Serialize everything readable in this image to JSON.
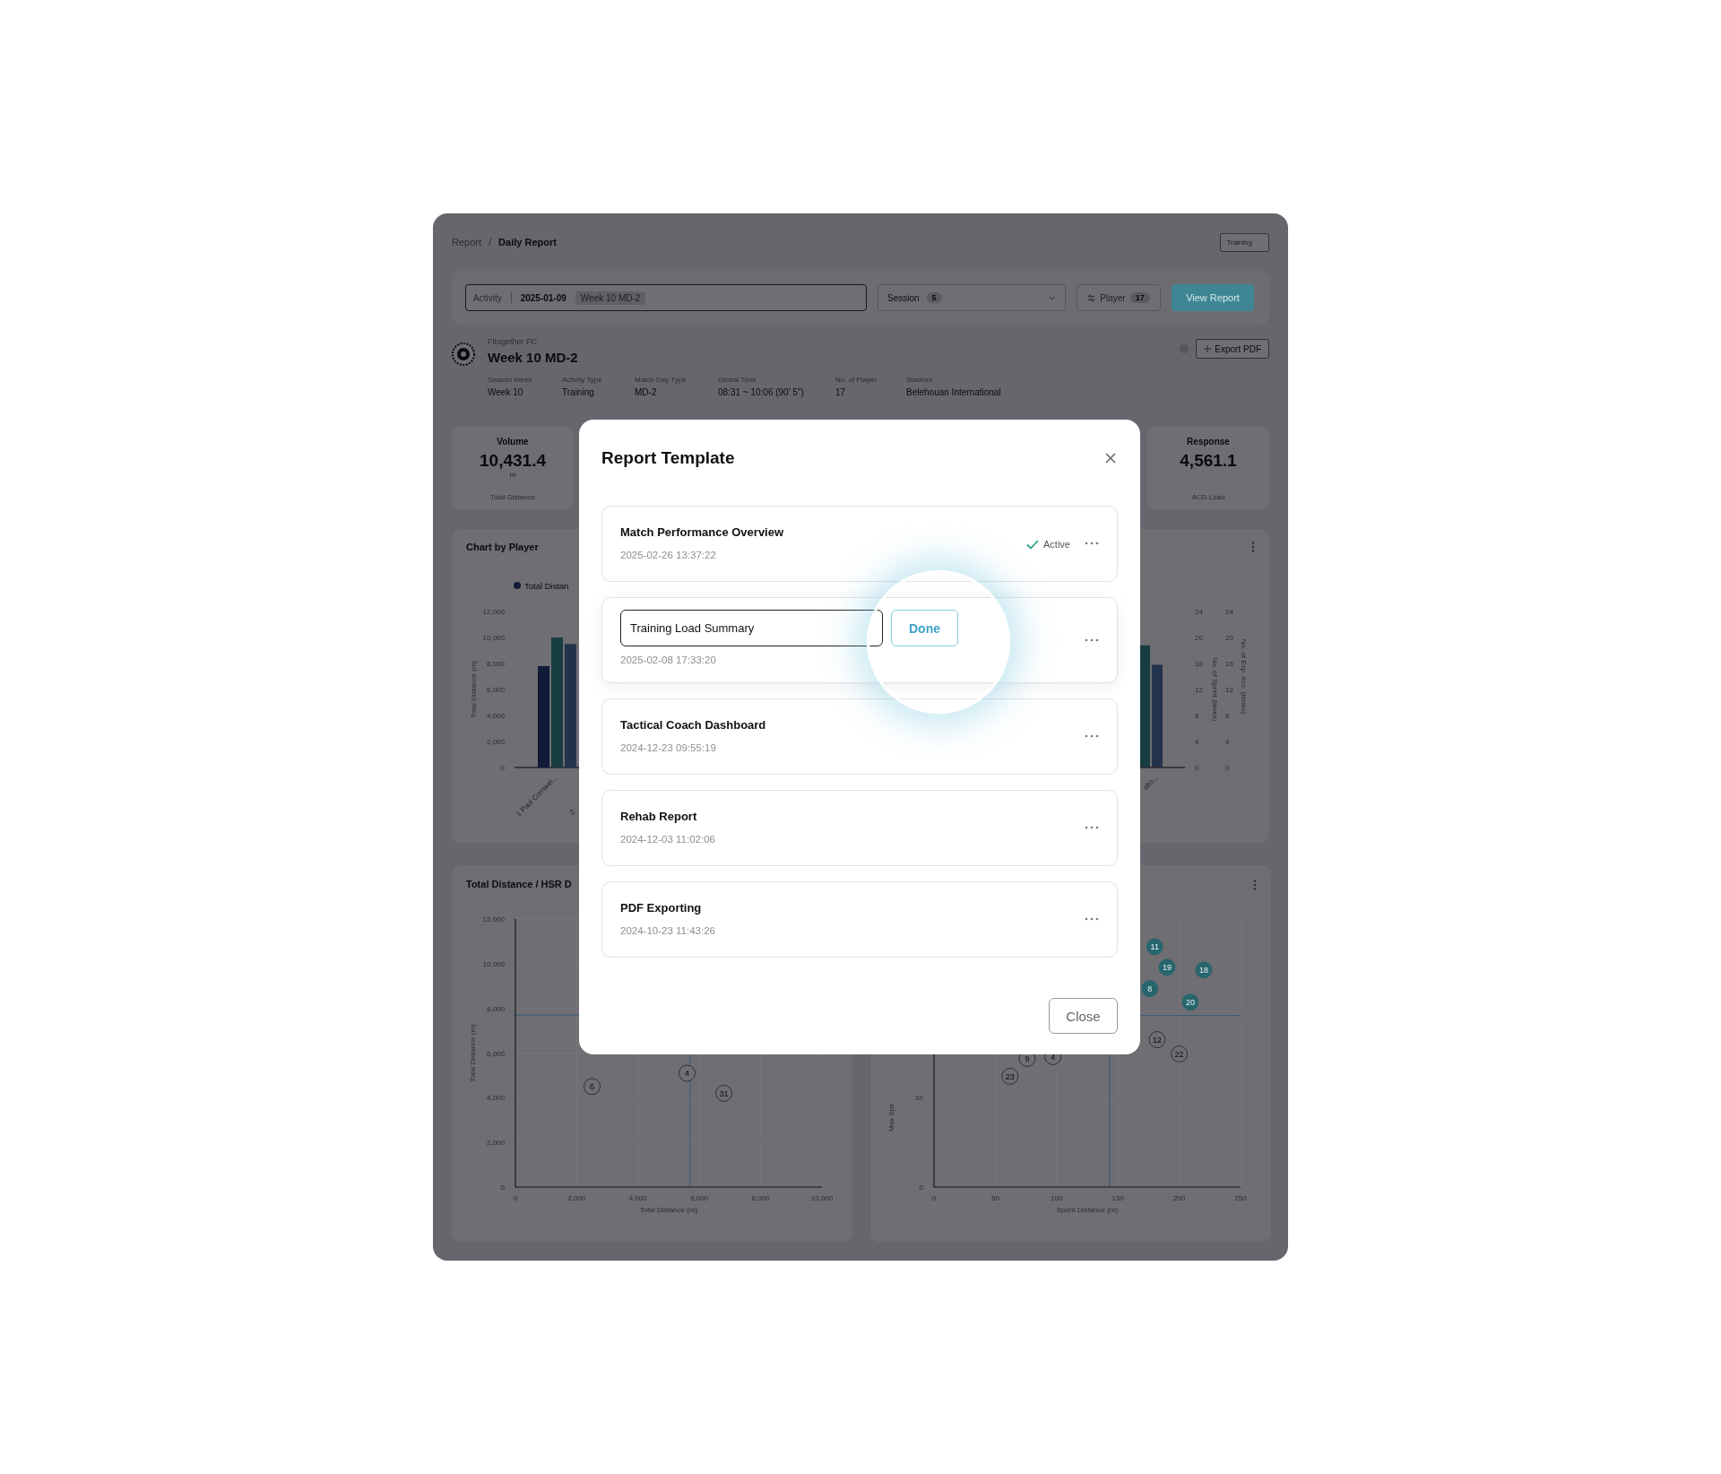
{
  "breadcrumb": {
    "parent": "Report",
    "separator": "/",
    "current": "Daily Report"
  },
  "mode_button": "Training",
  "filters": {
    "activity": {
      "label": "Activity",
      "date": "2025-01-09",
      "tag": "Week 10 MD-2"
    },
    "session": {
      "label": "Session",
      "count": "5"
    },
    "player": {
      "label": "Player",
      "count": "17"
    },
    "submit": "View Report"
  },
  "team": {
    "club": "Fitogether FC",
    "title": "Week 10 MD-2",
    "export": "Export PDF",
    "meta": [
      {
        "label": "Season Week",
        "value": "Week 10"
      },
      {
        "label": "Activity Type",
        "value": "Training"
      },
      {
        "label": "Match Day Type",
        "value": "MD-2"
      },
      {
        "label": "Global Time",
        "value": "08:31 ~ 10:06 (90' 5\")"
      },
      {
        "label": "No. of Player",
        "value": "17"
      },
      {
        "label": "Stadium",
        "value": "Belehouan International"
      }
    ]
  },
  "kpis": [
    {
      "title": "Volume",
      "value": "10,431.4",
      "unit": "m",
      "caption": "Total Distance"
    },
    {
      "title": "Response",
      "value": "4,561.1",
      "caption": "ACD Load"
    }
  ],
  "player_chart": {
    "title": "Chart by Player",
    "partial_label": "2",
    "chart_data": {
      "type": "bar",
      "stacked": false,
      "ylabel": "Total Distance (m)",
      "categories": [
        "1 Paul Cornwel..."
      ],
      "ylim": [
        0,
        12000
      ],
      "yticks": [
        {
          "value": 0,
          "label": "0"
        },
        {
          "value": 2000,
          "label": "2,000"
        },
        {
          "value": 4000,
          "label": "4,000"
        },
        {
          "value": 6000,
          "label": "6,000"
        },
        {
          "value": 8000,
          "label": "8,000"
        },
        {
          "value": 10000,
          "label": "10,000"
        },
        {
          "value": 12000,
          "label": "12,000"
        }
      ],
      "series": [
        {
          "name": "Total Distan",
          "color": "#111b37",
          "values": [
            7800
          ]
        },
        {
          "color": "#173d41",
          "values": [
            10000
          ]
        },
        {
          "color": "#24334c",
          "values": [
            9500
          ]
        }
      ]
    }
  },
  "player_chart_right": {
    "secondary_axis": {
      "label": "No. of Exp. Acc. (times)",
      "ticks": [
        "24",
        "20",
        "16",
        "12",
        "8",
        "4",
        "0"
      ]
    },
    "chart_data": {
      "type": "bar",
      "stacked": false,
      "categories": [
        "alto..."
      ],
      "ylim": [
        0,
        24
      ],
      "yticks": [
        0,
        4,
        8,
        12,
        16,
        20,
        24
      ],
      "ylabel": "No. of Sprint (times)",
      "series": [
        {
          "color": "#173d41",
          "values": [
            18.8
          ]
        },
        {
          "color": "#24334c",
          "values": [
            15.8
          ]
        }
      ]
    }
  },
  "scatter_charts": [
    {
      "title": "Total Distance / HSR D",
      "point_labels": [
        [
          "6",
          "4",
          "31"
        ]
      ],
      "chart_data": {
        "type": "scatter",
        "xlabel": "Total Distance (m)",
        "ylabel": "Total Distance (m)",
        "xlim": [
          0,
          10000
        ],
        "ylim": [
          0,
          12000
        ],
        "xticks": [
          {
            "value": 0,
            "label": "0"
          },
          {
            "value": 2000,
            "label": "2,000"
          },
          {
            "value": 4000,
            "label": "4,000"
          },
          {
            "value": 6000,
            "label": "6,000"
          },
          {
            "value": 8000,
            "label": "8,000"
          },
          {
            "value": 10000,
            "label": "10,000"
          }
        ],
        "yticks": [
          {
            "value": 0,
            "label": "0"
          },
          {
            "value": 2000,
            "label": "2,000"
          },
          {
            "value": 4000,
            "label": "4,000"
          },
          {
            "value": 6000,
            "label": "6,000"
          },
          {
            "value": 8000,
            "label": "8,000"
          },
          {
            "value": 10000,
            "label": "10,000"
          },
          {
            "value": 12000,
            "label": "12,000"
          }
        ],
        "grid": true,
        "ref_lines": [
          {
            "axis": "y",
            "value": 7700
          },
          {
            "axis": "x",
            "value": 5700
          }
        ],
        "series": [
          {
            "color": "#2f2f35",
            "x": [
              2500,
              5600,
              6800
            ],
            "values": [
              4500,
              5100,
              4200
            ]
          }
        ]
      }
    },
    {
      "menu": true,
      "point_labels": [
        [
          "23",
          "9",
          "4",
          "12",
          "22"
        ],
        [
          "20",
          "8",
          "19",
          "18",
          "11"
        ]
      ],
      "chart_data": {
        "type": "scatter",
        "xlabel": "Sprint Distance (m)",
        "ylabel": "Max Spe",
        "xlim": [
          0,
          250
        ],
        "ylim": [
          0,
          30
        ],
        "xticks": [
          0,
          50,
          100,
          150,
          200,
          250
        ],
        "yticks": [
          0,
          10
        ],
        "grid": true,
        "ref_lines": [
          {
            "axis": "y",
            "value": 19.2
          },
          {
            "axis": "x",
            "value": 143
          }
        ],
        "series": [
          {
            "color": "#2f2f35",
            "x": [
              62,
              76,
              97,
              182,
              200
            ],
            "values": [
              12.4,
              14.4,
              14.6,
              16.5,
              14.9
            ]
          },
          {
            "color": "#28666d",
            "x": [
              209,
              176,
              190,
              220,
              180
            ],
            "values": [
              20.7,
              22.2,
              24.6,
              24.3,
              26.9
            ]
          }
        ]
      }
    }
  ],
  "modal": {
    "title": "Report Template",
    "active_label": "Active",
    "close": "Close",
    "templates": [
      {
        "kind": "view",
        "name": "Match Performance Overview",
        "date": "2025-02-26 13:37:22",
        "active": true
      },
      {
        "kind": "editing",
        "value": "Training Load Summary",
        "done": "Done",
        "date": "2025-02-08 17:33:20",
        "active": false
      },
      {
        "kind": "view",
        "name": "Tactical Coach Dashboard",
        "date": "2024-12-23 09:55:19",
        "active": false
      },
      {
        "kind": "view",
        "name": "Rehab Report",
        "date": "2024-12-03 11:02:06",
        "active": false
      },
      {
        "kind": "view",
        "name": "PDF Exporting",
        "date": "2024-10-23 11:43:26",
        "active": false
      }
    ]
  }
}
